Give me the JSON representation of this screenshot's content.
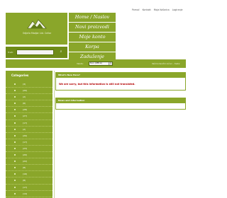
{
  "top_links": [
    "Pomoć",
    "Kontakt",
    "Moja Košarica",
    "Logiranje"
  ],
  "logo": {
    "text": "Odjeća Madjar Ltd. Cellar"
  },
  "search": {
    "label": "Traži:",
    "button_icon": "search-icon"
  },
  "menu": [
    {
      "label": "Home / Naslov"
    },
    {
      "label": "Novi proizvodi"
    },
    {
      "label": "Moje konto"
    },
    {
      "label": "Korpa"
    },
    {
      "label": "Zaduženje"
    }
  ],
  "toolbar": {
    "currency_label": "Valuta:",
    "currency_value": "Euro (Officio)",
    "right_text": "Vaši korisnički račun: , Kada:"
  },
  "sidebar": {
    "title": "Categories",
    "counts": [
      "(3)",
      "(20)",
      "(2)",
      "(6)",
      "(28)",
      "(27)",
      "(17)",
      "(2)",
      "(20)",
      "(17)",
      "(23)",
      "(20)",
      "(22)",
      "(8)",
      "(16)",
      "(8)",
      "(17)",
      "(14)"
    ]
  },
  "main": {
    "panel1_title": "What's New Here?",
    "error_message": "We are sorry, but this information is still not translated.",
    "panel2_title": "News and Information"
  },
  "colors": {
    "accent": "#8aa62a",
    "accent_dark": "#6f8c18",
    "error": "#b30000"
  }
}
